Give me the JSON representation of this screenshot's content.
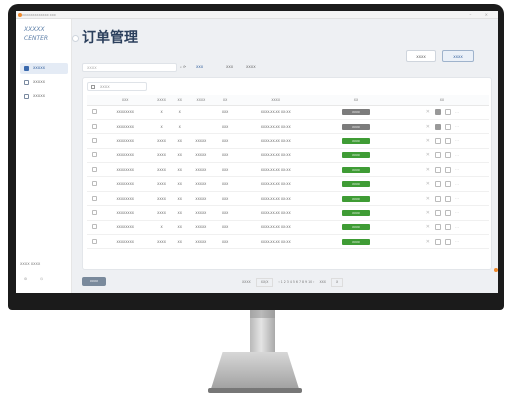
{
  "window": {
    "title": "XXXXXXXXXXXXX XXX",
    "controls": "– ×"
  },
  "sidebar": {
    "logo": "XXXXX CENTER",
    "items": [
      {
        "label": "XXXXX",
        "active": true
      },
      {
        "label": "XXXXX",
        "active": false
      },
      {
        "label": "XXXXX",
        "active": false
      }
    ],
    "footer_label": "XXXX XXXX",
    "footer_icons": "⚙ ⏻"
  },
  "header": {
    "title": "订单管理",
    "btn_a": "XXXX",
    "btn_b": "XXXX"
  },
  "filters": {
    "search_placeholder": "XXXX",
    "f1": "XXX",
    "f2": "XXX",
    "f3": "XXXX"
  },
  "table": {
    "tool_label": "XXXX",
    "columns": [
      "XXX",
      "XXXX",
      "XX",
      "XXXX",
      "XX",
      "XXXX",
      "XX",
      "XX"
    ],
    "rows": [
      {
        "id": "XXXXXXXX",
        "name": "X",
        "qty": "X",
        "code": "",
        "type": "XXX",
        "date": "XXXX-XX-XX XX:XX",
        "status": "XXXX",
        "gray": true,
        "filled": true
      },
      {
        "id": "XXXXXXXX",
        "name": "X",
        "qty": "X",
        "code": "",
        "type": "XXX",
        "date": "XXXX-XX-XX XX:XX",
        "status": "XXXX",
        "gray": true,
        "filled": true
      },
      {
        "id": "XXXXXXXX",
        "name": "XXXX",
        "qty": "XX",
        "code": "XXXXX",
        "type": "XXX",
        "date": "XXXX-XX-XX XX:XX",
        "status": "XXXX",
        "gray": false,
        "filled": false
      },
      {
        "id": "XXXXXXXX",
        "name": "XXXX",
        "qty": "XX",
        "code": "XXXXX",
        "type": "XXX",
        "date": "XXXX-XX-XX XX:XX",
        "status": "XXXX",
        "gray": false,
        "filled": false
      },
      {
        "id": "XXXXXXXX",
        "name": "XXXX",
        "qty": "XX",
        "code": "XXXXX",
        "type": "XXX",
        "date": "XXXX-XX-XX XX:XX",
        "status": "XXXX",
        "gray": false,
        "filled": false
      },
      {
        "id": "XXXXXXXX",
        "name": "XXXX",
        "qty": "XX",
        "code": "XXXXX",
        "type": "XXX",
        "date": "XXXX-XX-XX XX:XX",
        "status": "XXXX",
        "gray": false,
        "filled": false
      },
      {
        "id": "XXXXXXXX",
        "name": "XXXX",
        "qty": "XX",
        "code": "XXXXX",
        "type": "XXX",
        "date": "XXXX-XX-XX XX:XX",
        "status": "XXXX",
        "gray": false,
        "filled": false
      },
      {
        "id": "XXXXXXXX",
        "name": "XXXX",
        "qty": "XX",
        "code": "XXXXX",
        "type": "XXX",
        "date": "XXXX-XX-XX XX:XX",
        "status": "XXXX",
        "gray": false,
        "filled": false
      },
      {
        "id": "XXXXXXXX",
        "name": "X",
        "qty": "XX",
        "code": "XXXXX",
        "type": "XXX",
        "date": "XXXX-XX-XX XX:XX",
        "status": "XXXX",
        "gray": false,
        "filled": false
      },
      {
        "id": "XXXXXXXX",
        "name": "XXXX",
        "qty": "XX",
        "code": "XXXXX",
        "type": "XXX",
        "date": "XXXX-XX-XX XX:XX",
        "status": "XXXX",
        "gray": false,
        "filled": false
      }
    ]
  },
  "footer": {
    "button": "XXXX",
    "total": "XXXX",
    "page_size": "XX/X",
    "pages": "‹ 1 2 3 4 5 6 7 8 9 10 ›",
    "goto": "XXX",
    "goto_value": "X"
  },
  "colors": {
    "accent": "#3f9c35",
    "brand": "#2b3f5c",
    "orange": "#f08a2c"
  }
}
